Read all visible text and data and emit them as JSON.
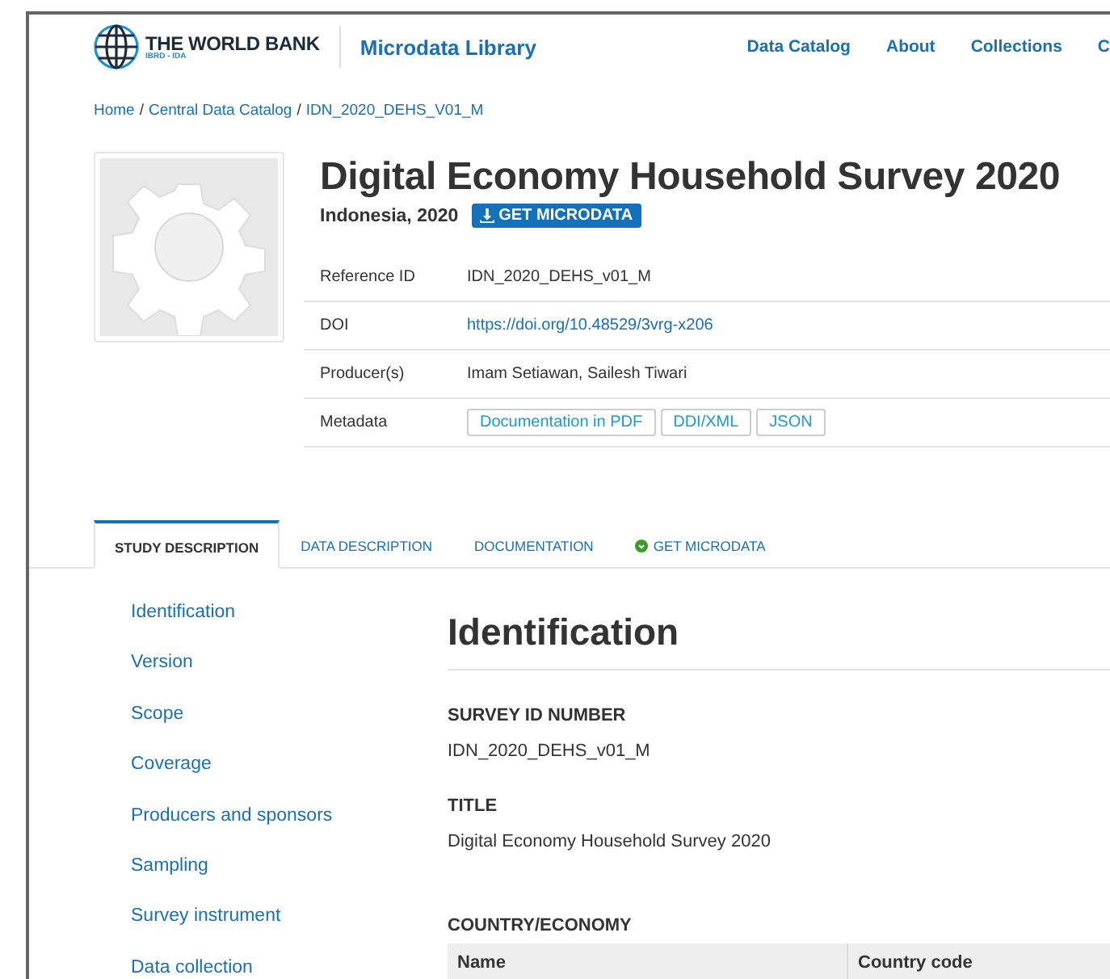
{
  "header": {
    "brand": "THE WORLD BANK",
    "brand_sub": "IBRD - IDA",
    "library": "Microdata Library",
    "nav": [
      {
        "label": "Data Catalog"
      },
      {
        "label": "About"
      },
      {
        "label": "Collections"
      },
      {
        "label": "C"
      }
    ]
  },
  "breadcrumb": {
    "separator": "/",
    "items": [
      "Home",
      "Central Data Catalog",
      "IDN_2020_DEHS_V01_M"
    ]
  },
  "study": {
    "title": "Digital Economy Household Survey 2020",
    "subtitle": "Indonesia, 2020",
    "get_button": "GET MICRODATA",
    "fields": [
      {
        "label": "Reference ID",
        "kind": "text",
        "value": "IDN_2020_DEHS_v01_M"
      },
      {
        "label": "DOI",
        "kind": "link",
        "value": "https://doi.org/10.48529/3vrg-x206"
      },
      {
        "label": "Producer(s)",
        "kind": "text",
        "value": "Imam Setiawan, Sailesh Tiwari"
      },
      {
        "label": "Metadata",
        "kind": "buttons",
        "buttons": [
          "Documentation in PDF",
          "DDI/XML",
          "JSON"
        ]
      }
    ]
  },
  "tabs": [
    {
      "label": "STUDY DESCRIPTION",
      "selected": true,
      "kind": "plain"
    },
    {
      "label": "DATA DESCRIPTION",
      "selected": false,
      "kind": "plain"
    },
    {
      "label": "DOCUMENTATION",
      "selected": false,
      "kind": "plain"
    },
    {
      "label": "GET MICRODATA",
      "selected": false,
      "kind": "download"
    }
  ],
  "sidebar": {
    "items": [
      "Identification",
      "Version",
      "Scope",
      "Coverage",
      "Producers and sponsors",
      "Sampling",
      "Survey instrument",
      "Data collection"
    ]
  },
  "content": {
    "heading": "Identification",
    "sections": [
      {
        "label": "SURVEY ID NUMBER",
        "value": "IDN_2020_DEHS_v01_M"
      },
      {
        "label": "TITLE",
        "value": "Digital Economy Household Survey 2020"
      }
    ],
    "table_title": "COUNTRY/ECONOMY",
    "table_columns": [
      "Name",
      "Country code"
    ]
  }
}
